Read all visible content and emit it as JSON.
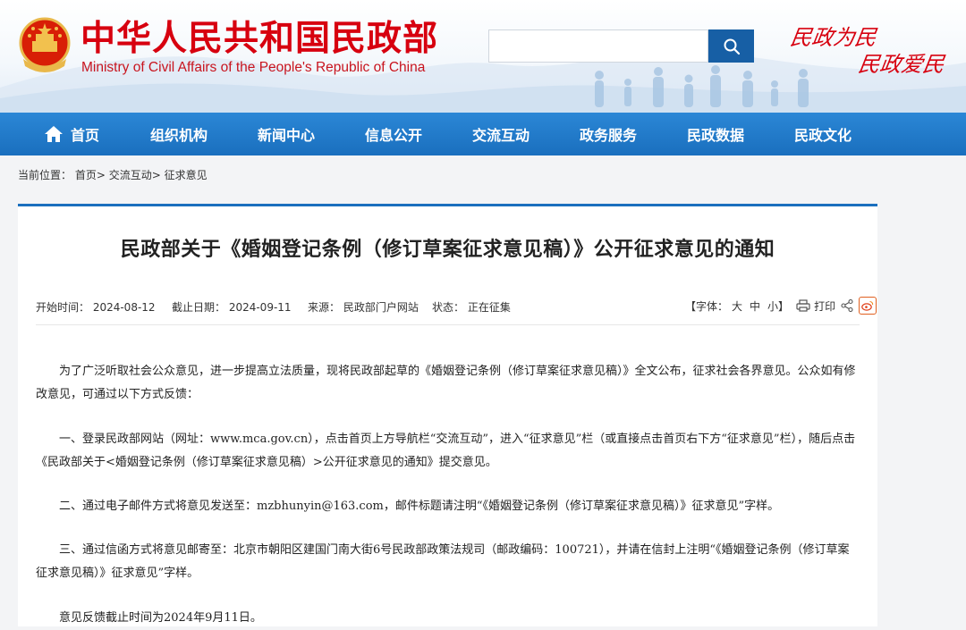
{
  "header": {
    "site_title": "中华人民共和国民政部",
    "site_subtitle": "Ministry of Civil Affairs of the People's Republic of China",
    "search_placeholder": "",
    "slogan_line1": "民政为民",
    "slogan_line2": "民政爱民"
  },
  "nav": {
    "items": [
      "首页",
      "组织机构",
      "新闻中心",
      "信息公开",
      "交流互动",
      "政务服务",
      "民政数据",
      "民政文化"
    ]
  },
  "breadcrumb": {
    "prefix": "当前位置：",
    "items": [
      "首页",
      "交流互动",
      "征求意见"
    ],
    "sep": "> "
  },
  "article": {
    "title": "民政部关于《婚姻登记条例（修订草案征求意见稿）》公开征求意见的通知",
    "meta": {
      "start": "开始时间：  2024-08-12",
      "deadline": "截止日期：  2024-09-11",
      "source": "来源：  民政部门户网站",
      "status": "状态：  正在征集"
    },
    "tools": {
      "font_label": "【字体：",
      "font_large": "大",
      "font_medium": "中",
      "font_small": "小】",
      "print_label": "打印"
    },
    "paragraphs": [
      "为了广泛听取社会公众意见，进一步提高立法质量，现将民政部起草的《婚姻登记条例（修订草案征求意见稿）》全文公布，征求社会各界意见。公众如有修改意见，可通过以下方式反馈：",
      "一、登录民政部网站（网址：www.mca.gov.cn），点击首页上方导航栏“交流互动”，进入“征求意见”栏（或直接点击首页右下方“征求意见”栏），随后点击《民政部关于<婚姻登记条例（修订草案征求意见稿）>公开征求意见的通知》提交意见。",
      "二、通过电子邮件方式将意见发送至：mzbhunyin@163.com，邮件标题请注明“《婚姻登记条例（修订草案征求意见稿）》征求意见”字样。",
      "三、通过信函方式将意见邮寄至：北京市朝阳区建国门南大街6号民政部政策法规司（邮政编码：100721），并请在信封上注明“《婚姻登记条例（修订草案征求意见稿）》征求意见”字样。",
      "意见反馈截止时间为2024年9月11日。"
    ]
  },
  "colors": {
    "brand_red": "#d7000f",
    "nav_blue": "#1a6fbe",
    "search_blue": "#175fa5"
  }
}
